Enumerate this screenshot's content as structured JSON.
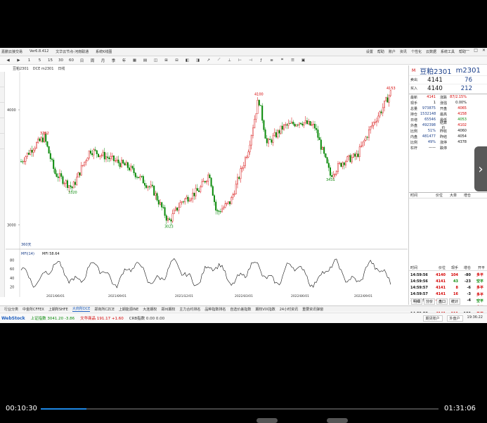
{
  "window": {
    "title_items": [
      "嘉鹏云接交易",
      "Ver6.8.412",
      "文华云节点-河南联通",
      "系统K线图"
    ],
    "menu_items": [
      "设置",
      "帮助",
      "账户",
      "资讯",
      "个性化",
      "云数据",
      "系统工具",
      "帮助"
    ],
    "controls": [
      "—",
      "□",
      "✕"
    ]
  },
  "toolbar": {
    "icons": [
      "◀",
      "▶",
      "1",
      "5",
      "15",
      "30",
      "60",
      "日",
      "周",
      "月",
      "季",
      "年",
      "▦",
      "▤",
      "◫",
      "⊞",
      "⊟",
      "◧",
      "◨",
      "↗",
      "⟋",
      "⊥",
      "⊢",
      "⊣",
      "ƒ",
      "≡",
      "⌗",
      "☰",
      "▣"
    ]
  },
  "chart_header": {
    "symbol_tab": "豆粕2301",
    "indicator": "DCE m2301",
    "period": "日线"
  },
  "chart_data": [
    {
      "type": "candlestick",
      "title": "豆粕2301",
      "y_tick_labels": [
        "4000",
        "3000"
      ],
      "x_tick_labels": [
        "2021/06/01",
        "2021/09/01",
        "2021/12/01",
        "2022/03/01",
        "2022/06/01",
        "2022/09/01"
      ],
      "annotations": [
        "3762",
        "3320",
        "3023",
        "4100",
        "3431",
        "4153"
      ],
      "corner_label": "360天"
    },
    {
      "type": "line",
      "title": "MFI(14)",
      "series_label": "MFI  58.64",
      "y_tick_labels": [
        "80",
        "60",
        "40",
        "20"
      ],
      "ylim": [
        0,
        100
      ]
    }
  ],
  "quote": {
    "badge": "M",
    "name": "豆粕2301",
    "code": "m2301",
    "sell": {
      "label": "卖出",
      "price": "4141",
      "vol": "76"
    },
    "buy": {
      "label": "买入",
      "price": "4140",
      "vol": "212"
    },
    "rows": [
      {
        "l1": "最新",
        "v1": "4141",
        "l2": "涨跌",
        "v2": "87/2.15%"
      },
      {
        "l1": "现手",
        "v1": "1",
        "l2": "涨强",
        "v2": "0.00%"
      },
      {
        "l1": "总量",
        "v1": "973875",
        "l2": "开盘",
        "v2": "4065"
      },
      {
        "l1": "持仓",
        "v1": "1532148",
        "l2": "最高",
        "v2": "4158"
      },
      {
        "l1": "日增",
        "v1": "65546",
        "l2": "最低",
        "v2": "4053"
      },
      {
        "l1": "外盘",
        "v1": "492398",
        "l2": "结算价",
        "v2": "4102"
      },
      {
        "l1": "比例",
        "v1": "51%",
        "l2": "昨收",
        "v2": "4060"
      },
      {
        "l1": "内盘",
        "v1": "481477",
        "l2": "昨结",
        "v2": "4054"
      },
      {
        "l1": "比例",
        "v1": "49%",
        "l2": "涨停",
        "v2": "4378"
      },
      {
        "l1": "杠杆",
        "v1": "——",
        "l2": "跌停",
        "v2": ""
      }
    ]
  },
  "minute_header": [
    "时间",
    "价位",
    "大单",
    "增仓"
  ],
  "ticks_header": [
    "时间",
    "价位",
    "现手",
    "增仓",
    "开平"
  ],
  "ticks": [
    {
      "time": "14:59:56",
      "price": "4140",
      "vol": "104",
      "oi": "-80",
      "type": "多平"
    },
    {
      "time": "14:59:56",
      "price": "4141",
      "vol": "43",
      "oi": "-23",
      "type": "空平"
    },
    {
      "time": "14:59:57",
      "price": "4141",
      "vol": "8",
      "oi": "-6",
      "type": "多平"
    },
    {
      "time": "14:59:57",
      "price": "4141",
      "vol": "16",
      "oi": "-3",
      "type": "多平"
    },
    {
      "time": "14:59:58",
      "price": "4142",
      "vol": "6",
      "oi": "-4",
      "type": "空平"
    },
    {
      "time": "14:59:58",
      "price": "4142",
      "vol": "11",
      "oi": "-9",
      "type": "多平"
    },
    {
      "time": "14:59:58",
      "price": "4141",
      "vol": "111",
      "oi": "-102",
      "type": "多平"
    },
    {
      "time": "14:59:58",
      "price": "4141",
      "vol": "16",
      "oi": "-12",
      "type": "空平"
    },
    {
      "time": "14:59:59",
      "price": "4141",
      "vol": "1",
      "oi": "-1",
      "type": "双平"
    }
  ],
  "panel_tabs": [
    "明细",
    "分价",
    "盘口",
    "统计"
  ],
  "bottom_tabs": [
    "行业分类",
    "中金所CFFEX",
    "上期所SHFE",
    "大商所DCE",
    "郑商所CZCE",
    "上期能源INE",
    "大连期权",
    "郑州期权",
    "主力合约排名",
    "品种指数排名",
    "自选价差指数",
    "期权VIX指数",
    "24小时资讯",
    "重要资讯弹窗"
  ],
  "bottom_active": "大商所DCE",
  "status": {
    "logo": "WebStock",
    "idx1": "上证指数  3041.20  -3.86",
    "idx2": "文华商品  191.17  +1.60",
    "idx3": "CRB指数  0.00  0.00",
    "btn1": "期货账户",
    "btn2": "外盘户",
    "time": "19:36:22"
  },
  "video": {
    "elapsed": "00:10:30",
    "total": "01:31:06",
    "progress": 0.115
  }
}
